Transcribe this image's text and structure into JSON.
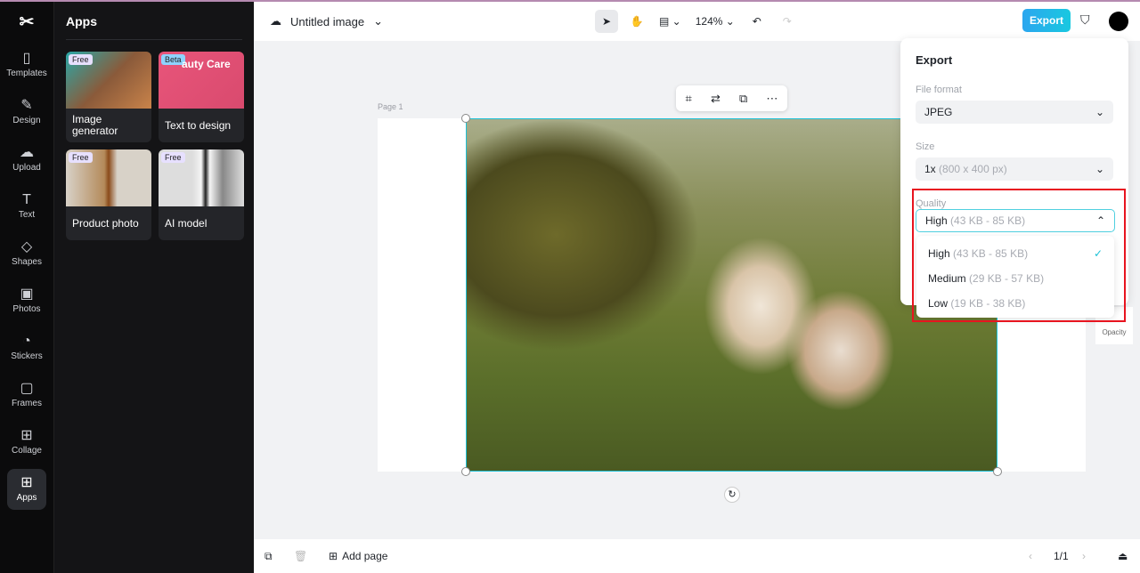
{
  "rail": [
    {
      "label": "Templates",
      "icon": "▯"
    },
    {
      "label": "Design",
      "icon": "✎"
    },
    {
      "label": "Upload",
      "icon": "☁"
    },
    {
      "label": "Text",
      "icon": "T"
    },
    {
      "label": "Shapes",
      "icon": "◇"
    },
    {
      "label": "Photos",
      "icon": "▣"
    },
    {
      "label": "Stickers",
      "icon": "◔"
    },
    {
      "label": "Frames",
      "icon": "▢"
    },
    {
      "label": "Collage",
      "icon": "⊞"
    },
    {
      "label": "Apps",
      "icon": "⊞"
    }
  ],
  "panel": {
    "title": "Apps",
    "cards": [
      {
        "label": "Image generator",
        "badge": "Free"
      },
      {
        "label": "Text to design",
        "badge": "Beta",
        "overlay": "auty Care"
      },
      {
        "label": "Product photo",
        "badge": "Free"
      },
      {
        "label": "AI model",
        "badge": "Free"
      }
    ]
  },
  "topbar": {
    "title": "Untitled image",
    "zoom": "124%",
    "export": "Export"
  },
  "canvas": {
    "page_label": "Page 1"
  },
  "bottombar": {
    "add_page": "Add page",
    "pages": "1/1"
  },
  "export_panel": {
    "title": "Export",
    "file_format_label": "File format",
    "file_format": "JPEG",
    "size_label": "Size",
    "size": "1x",
    "size_detail": "(800 x 400 px)",
    "quality_label": "Quality",
    "quality": "High",
    "quality_detail": "(43 KB - 85 KB)",
    "options": [
      {
        "label": "High",
        "detail": "(43 KB - 85 KB)",
        "selected": true
      },
      {
        "label": "Medium",
        "detail": "(29 KB - 57 KB)"
      },
      {
        "label": "Low",
        "detail": "(19 KB - 38 KB)"
      }
    ]
  },
  "opacity_label": "Opacity",
  "colors": {
    "accent": "#1cc1d6",
    "highlight": "#e8141f"
  }
}
